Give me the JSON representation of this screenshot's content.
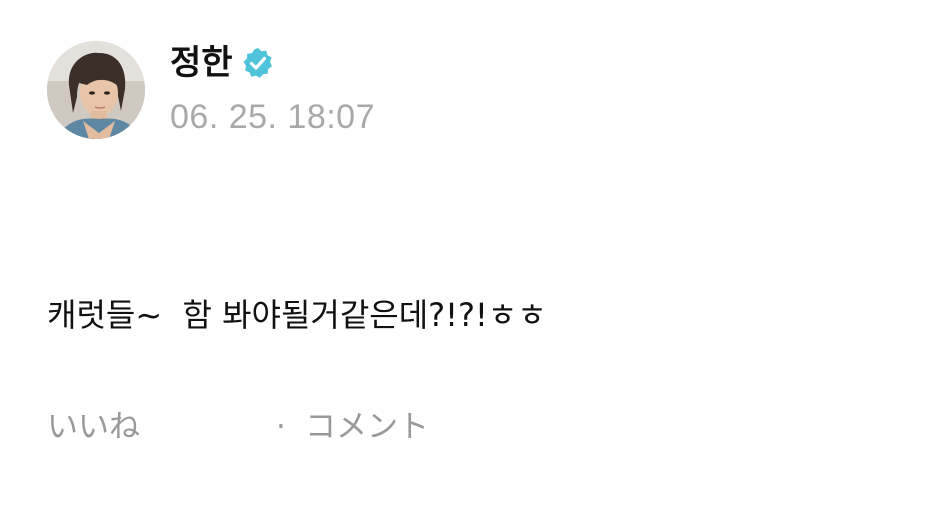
{
  "post": {
    "author": {
      "name": "정한",
      "verified": true,
      "avatar_icon": "profile-photo",
      "verified_icon": "verified-badge-icon",
      "verified_color": "#4fc3d9"
    },
    "timestamp": "06. 25. 18:07",
    "text": "캐럿들~  함 봐야될거같은데?!?!ㅎㅎ"
  },
  "actions": {
    "like_label": "いいね",
    "separator": "·",
    "comment_label": "コメント"
  },
  "colors": {
    "text_primary": "#111111",
    "text_secondary": "#a9a9a9",
    "action_text": "#999999",
    "background": "#ffffff"
  }
}
